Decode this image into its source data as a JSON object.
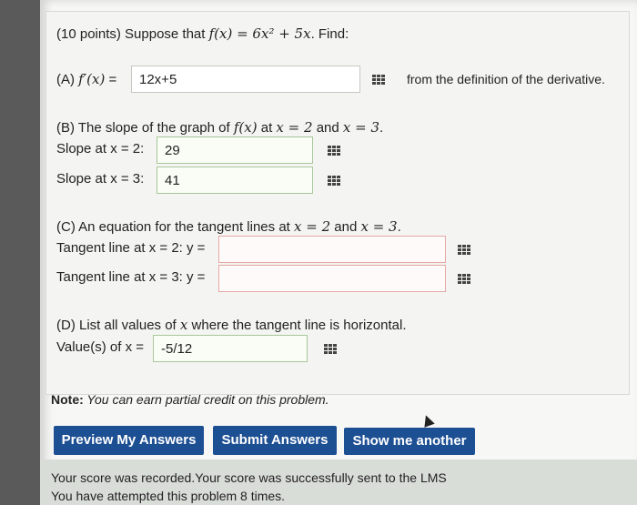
{
  "problem": {
    "intro_prefix": "(10 points) Suppose that ",
    "intro_math": "f(x) = 6x² + 5x",
    "intro_suffix": ". Find:"
  },
  "partA": {
    "label_prefix": "(A) ",
    "label_math": "f′(x)",
    "label_eq": " = ",
    "answer": "12x+5",
    "suffix": "from the definition of the derivative."
  },
  "partB": {
    "label_prefix": "(B) The slope of the graph of ",
    "label_math1": "f(x)",
    "label_mid": " at ",
    "label_math2": "x = 2",
    "label_and": " and ",
    "label_math3": "x = 3",
    "label_end": ".",
    "slope2_label": "Slope at x = 2:",
    "slope2_answer": "29",
    "slope3_label": "Slope at x = 3:",
    "slope3_answer": "41"
  },
  "partC": {
    "label_prefix": "(C) An equation for the tangent lines at ",
    "label_math1": "x = 2",
    "label_and": " and ",
    "label_math2": "x = 3",
    "label_end": ".",
    "line2_label": "Tangent line at x = 2: y =",
    "line2_answer": "",
    "line3_label": "Tangent line at x = 3: y =",
    "line3_answer": ""
  },
  "partD": {
    "label_prefix": "(D) List all values of ",
    "label_math": "x",
    "label_suffix": " where the tangent line is horizontal.",
    "values_label": "Value(s) of x =",
    "values_answer": "-5/12"
  },
  "note": {
    "bold": "Note:",
    "text": " You can earn partial credit on this problem."
  },
  "buttons": {
    "preview": "Preview My Answers",
    "submit": "Submit Answers",
    "another": "Show me another"
  },
  "status": {
    "line1": "Your score was recorded.Your score was successfully sent to the LMS",
    "line2": "You have attempted this problem 8 times."
  }
}
